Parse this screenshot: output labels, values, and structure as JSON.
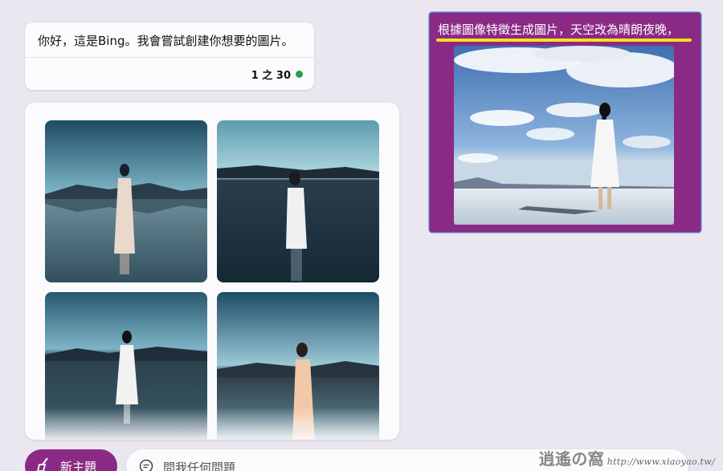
{
  "bot_message": {
    "greeting": "你好，這是Bing。我會嘗試創建你想要的圖片。",
    "counter": "1 之 30",
    "status_color": "#23a04a"
  },
  "generated_images": {
    "count": 4,
    "description_color": "#1f5e78"
  },
  "user_message": {
    "prompt": "根據圖像特徵生成圖片，天空改為晴朗夜晚，",
    "accent_color": "#8b2a85",
    "highlight_color": "#f5e21a"
  },
  "composer": {
    "new_topic_label": "新主題",
    "placeholder": "問我任何問題",
    "new_topic_icon": "broom-icon",
    "input_icon": "chat-icon"
  },
  "watermark": {
    "brand": "逍遙の窩",
    "url": "http://www.xiaoyao.tw/"
  }
}
